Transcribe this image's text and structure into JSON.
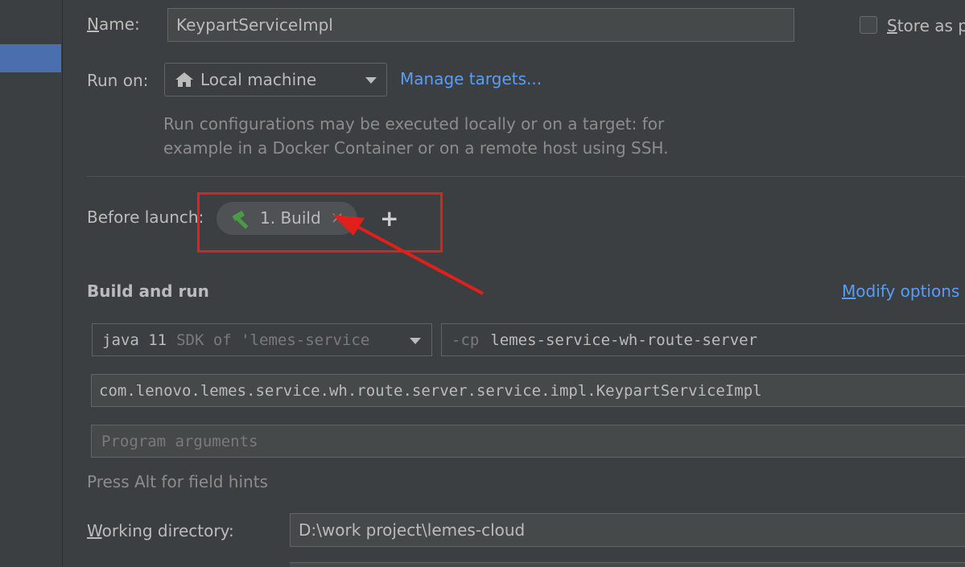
{
  "name_field": {
    "label": "Name:",
    "mnemonic": "N",
    "rest": "ame:",
    "value": "KeypartServiceImpl"
  },
  "store_as": {
    "mnemonic": "S",
    "rest": "tore as p"
  },
  "run_on": {
    "label": "Run on:",
    "selected": "Local machine",
    "manage_link": "Manage targets...",
    "description_line1": "Run configurations may be executed locally or on a target: for",
    "description_line2": "example in a Docker Container or on a remote host using SSH."
  },
  "before_launch": {
    "label": "Before launch:",
    "task": "1. Build",
    "add": "+"
  },
  "build_and_run": {
    "title": "Build and run",
    "modify_mnemonic": "M",
    "modify_rest": "odify options",
    "sdk_java": "java 11",
    "sdk_detail": "SDK of 'lemes-service",
    "cp_prefix": "-cp",
    "cp_value": "lemes-service-wh-route-server",
    "main_class": "com.lenovo.lemes.service.wh.route.server.service.impl.KeypartServiceImpl",
    "program_args_placeholder": "Program arguments",
    "field_hint": "Press Alt for field hints"
  },
  "working_dir": {
    "mnemonic": "W",
    "rest": "orking directory:",
    "value": "D:\\work project\\lemes-cloud"
  },
  "colors": {
    "background": "#3c3f41",
    "link": "#589df6",
    "selection": "#4b6eaf",
    "highlight": "#e0201a",
    "hammer": "#4a9a4a"
  }
}
